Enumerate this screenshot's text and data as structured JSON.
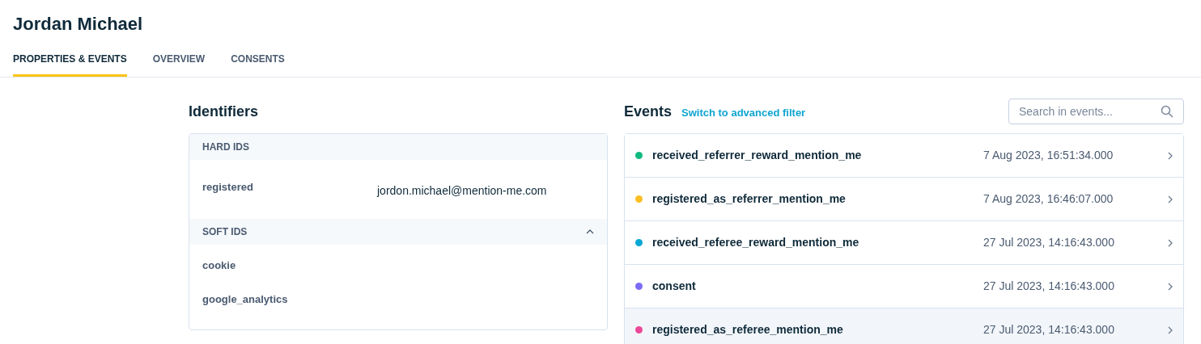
{
  "title": "Jordan Michael",
  "tabs": [
    {
      "label": "PROPERTIES & EVENTS",
      "selected": true
    },
    {
      "label": "OVERVIEW",
      "selected": false
    },
    {
      "label": "CONSENTS",
      "selected": false
    }
  ],
  "identifiers": {
    "heading": "Identifiers",
    "groups": [
      {
        "label": "HARD IDS",
        "collapsible": false,
        "items": [
          {
            "name": "registered",
            "value": "jordon.michael@mention-me.com"
          }
        ]
      },
      {
        "label": "SOFT IDS",
        "collapsible": true,
        "expanded": true,
        "items": [
          {
            "name": "cookie"
          },
          {
            "name": "google_analytics"
          }
        ]
      }
    ]
  },
  "events": {
    "heading": "Events",
    "filter_link": "Switch to advanced filter",
    "search": {
      "placeholder": "Search in events..."
    },
    "rows": [
      {
        "name": "received_referrer_reward_mention_me",
        "time": "7 Aug 2023, 16:51:34.000",
        "color": "#10b981",
        "highlighted": false
      },
      {
        "name": "registered_as_referrer_mention_me",
        "time": "7 Aug 2023, 16:46:07.000",
        "color": "#fbbf24",
        "highlighted": false
      },
      {
        "name": "received_referee_reward_mention_me",
        "time": "27 Jul 2023, 14:16:43.000",
        "color": "#06a8d4",
        "highlighted": false
      },
      {
        "name": "consent",
        "time": "27 Jul 2023, 14:16:43.000",
        "color": "#7c6cf5",
        "highlighted": false
      },
      {
        "name": "registered_as_referee_mention_me",
        "time": "27 Jul 2023, 14:16:43.000",
        "color": "#ec4899",
        "highlighted": true
      }
    ]
  }
}
